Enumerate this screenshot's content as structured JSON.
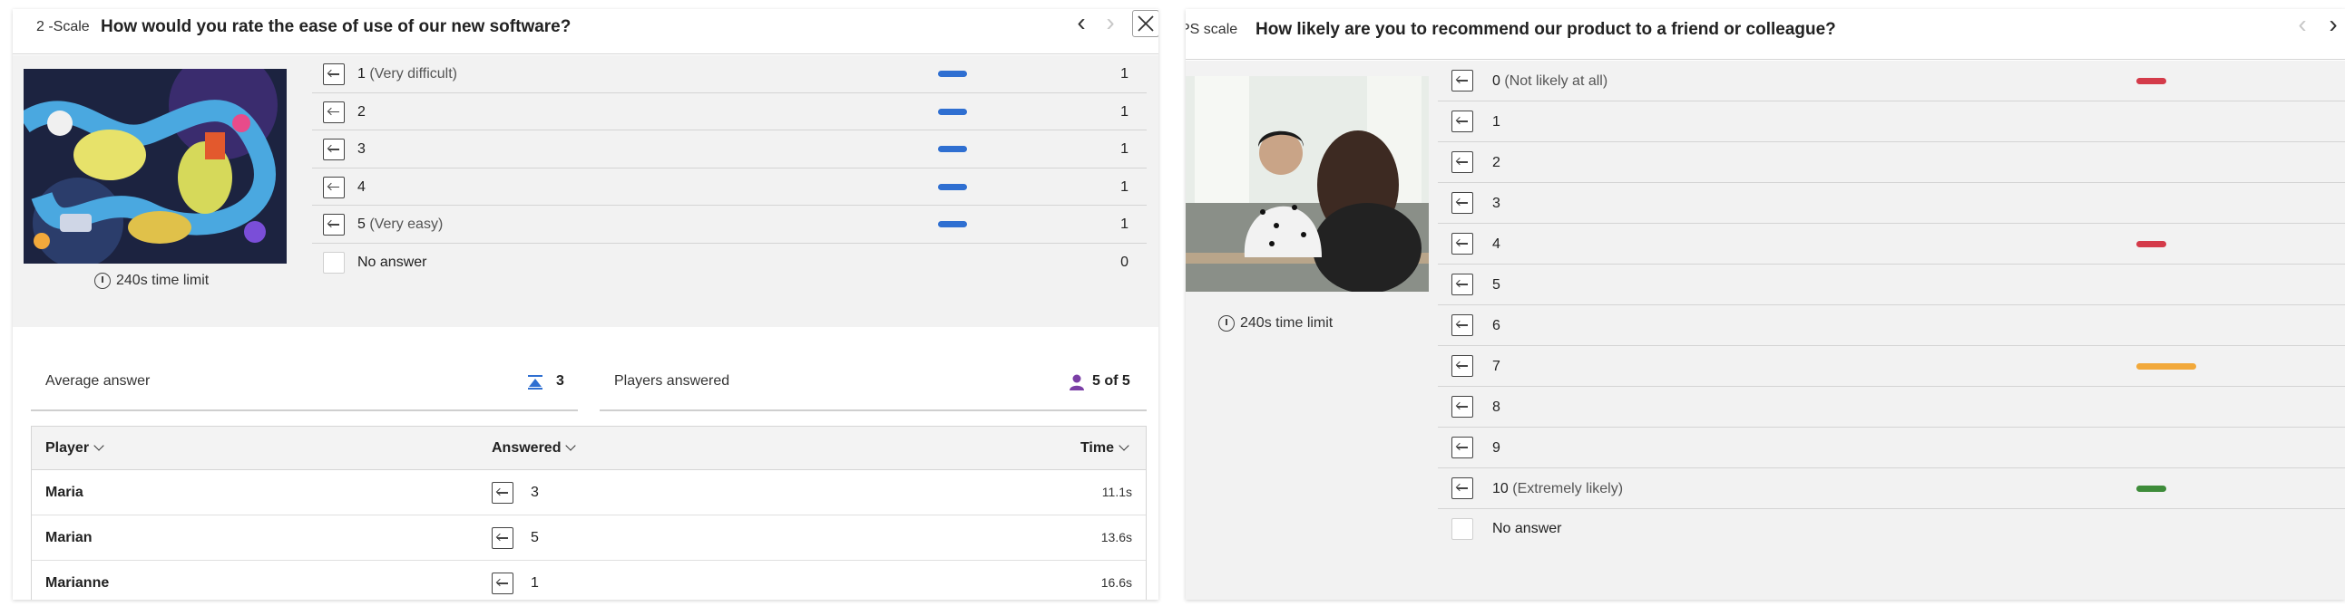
{
  "left_panel": {
    "type_label": "2 -Scale",
    "question": "How would you rate the ease of use of our new software?",
    "time_limit": "240s time limit",
    "answers": [
      {
        "label": "1",
        "sub": "(Very difficult)",
        "count": "1",
        "fraction": 1.0
      },
      {
        "label": "2",
        "sub": "",
        "count": "1",
        "fraction": 1.0
      },
      {
        "label": "3",
        "sub": "",
        "count": "1",
        "fraction": 1.0
      },
      {
        "label": "4",
        "sub": "",
        "count": "1",
        "fraction": 1.0
      },
      {
        "label": "5",
        "sub": "(Very easy)",
        "count": "1",
        "fraction": 1.0
      }
    ],
    "no_answer": {
      "label": "No answer",
      "count": "0"
    },
    "bar_color": "#2f6fd1",
    "stats": {
      "average_label": "Average answer",
      "average_value": "3",
      "players_label": "Players answered",
      "players_value": "5 of 5"
    },
    "table": {
      "headers": {
        "player": "Player",
        "answered": "Answered",
        "time": "Time"
      },
      "rows": [
        {
          "player": "Maria",
          "answered": "3",
          "time": "11.1s"
        },
        {
          "player": "Marian",
          "answered": "5",
          "time": "13.6s"
        },
        {
          "player": "Marianne",
          "answered": "1",
          "time": "16.6s"
        }
      ]
    }
  },
  "right_panel": {
    "type_label": "PS scale",
    "question": "How likely are you to recommend our product to a friend or colleague?",
    "time_limit": "240s time limit",
    "answers": [
      {
        "label": "0",
        "sub": "(Not likely at all)",
        "fraction": 0.5,
        "color": "#d43b4a"
      },
      {
        "label": "1",
        "sub": "",
        "fraction": 0,
        "color": ""
      },
      {
        "label": "2",
        "sub": "",
        "fraction": 0,
        "color": ""
      },
      {
        "label": "3",
        "sub": "",
        "fraction": 0,
        "color": ""
      },
      {
        "label": "4",
        "sub": "",
        "fraction": 0.5,
        "color": "#d43b4a"
      },
      {
        "label": "5",
        "sub": "",
        "fraction": 0,
        "color": ""
      },
      {
        "label": "6",
        "sub": "",
        "fraction": 0,
        "color": ""
      },
      {
        "label": "7",
        "sub": "",
        "fraction": 1.0,
        "color": "#f2a93b"
      },
      {
        "label": "8",
        "sub": "",
        "fraction": 0,
        "color": ""
      },
      {
        "label": "9",
        "sub": "",
        "fraction": 0,
        "color": ""
      },
      {
        "label": "10",
        "sub": "(Extremely likely)",
        "fraction": 0.5,
        "color": "#3e8c3a"
      }
    ],
    "no_answer": {
      "label": "No answer"
    }
  },
  "icons": {
    "prev": "chevron-left-icon",
    "next": "chevron-right-icon",
    "close": "close-icon",
    "average": "average-icon",
    "players": "user-icon",
    "clock": "clock-icon",
    "option": "option-icon"
  },
  "colors": {
    "average_icon": "#2f6fd1",
    "players_icon": "#7b3fa6"
  }
}
